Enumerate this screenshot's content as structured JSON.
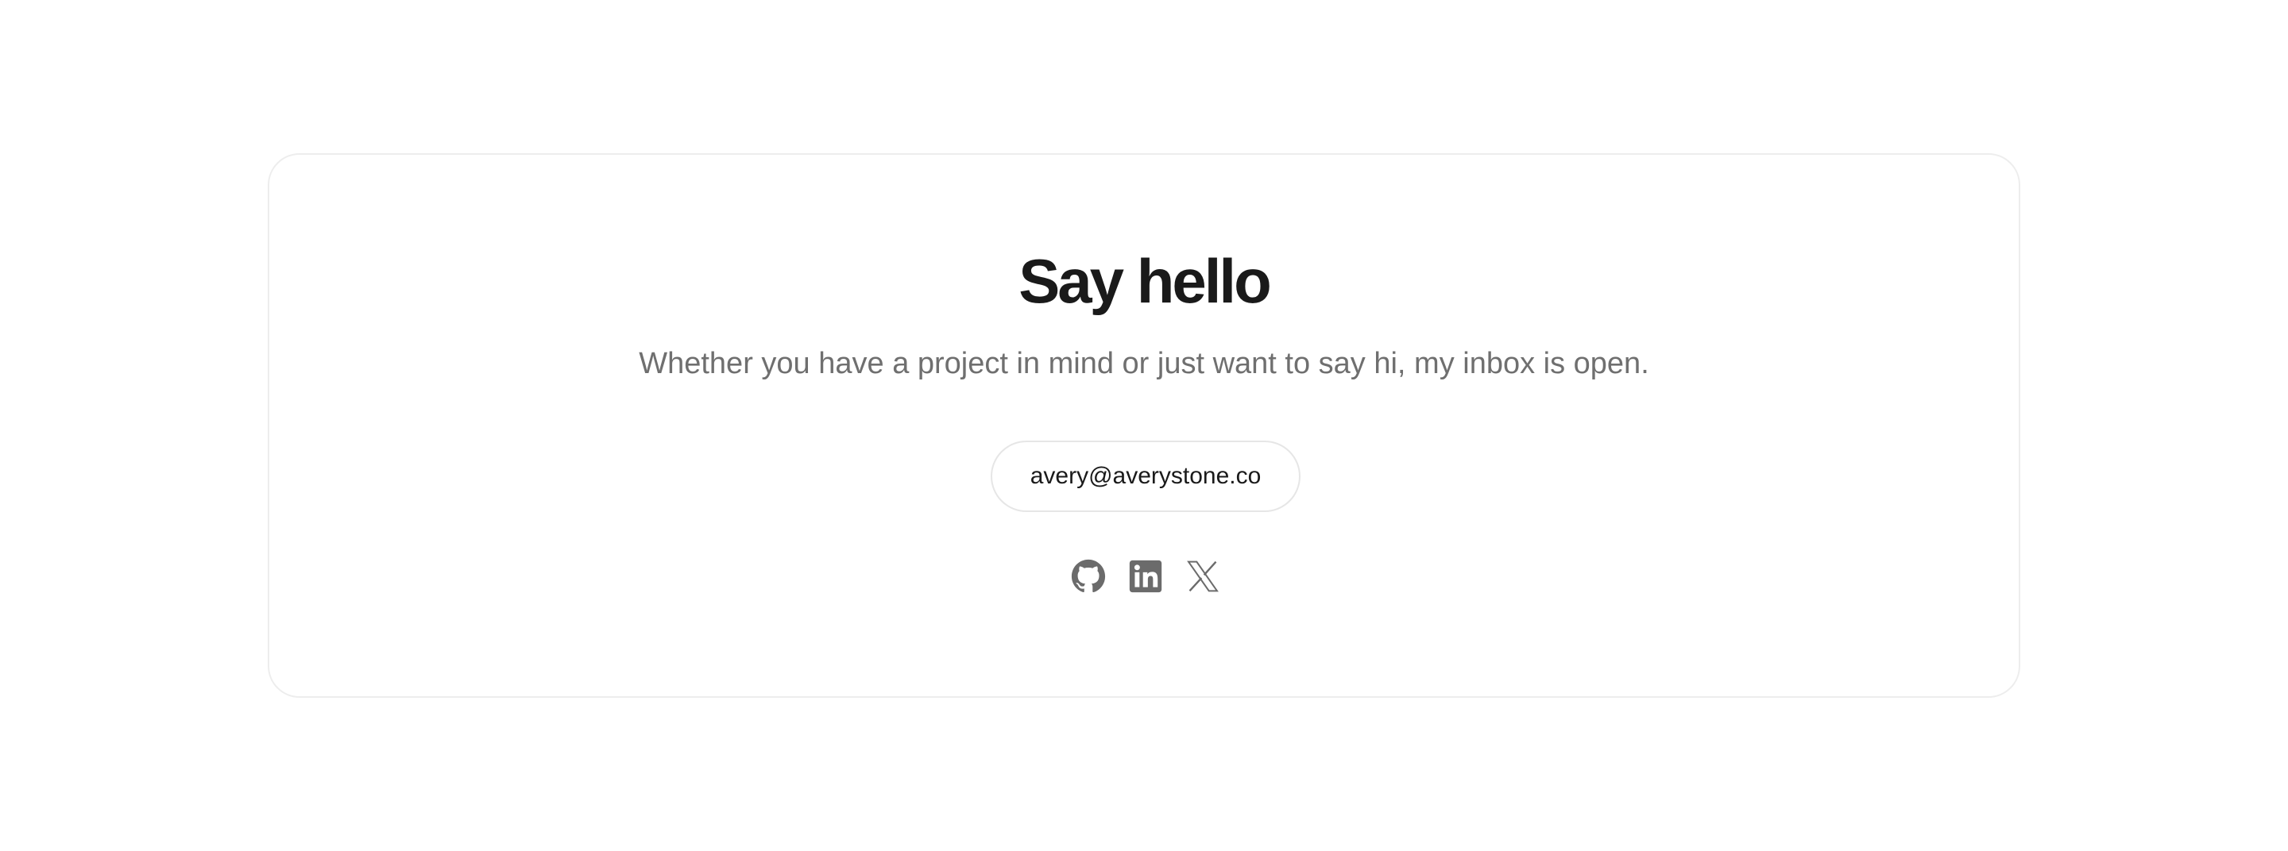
{
  "contact": {
    "title": "Say hello",
    "subtitle": "Whether you have a project in mind or just want to say hi, my inbox is open.",
    "email": "avery@averystone.co",
    "socials": [
      {
        "name": "GitHub",
        "icon": "github-icon"
      },
      {
        "name": "LinkedIn",
        "icon": "linkedin-icon"
      },
      {
        "name": "X",
        "icon": "x-icon"
      }
    ]
  },
  "colors": {
    "title": "#1a1a1a",
    "subtitle": "#6f6f6f",
    "icon": "#6b6b6b",
    "card_border": "#ededed",
    "button_border": "#e6e6e6"
  }
}
